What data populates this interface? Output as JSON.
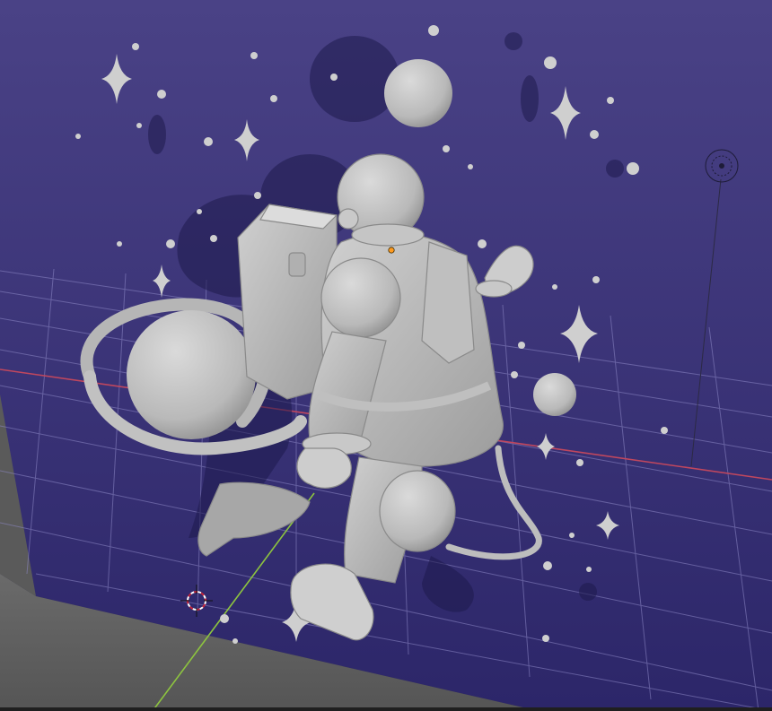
{
  "viewport": {
    "view": "3D Viewport",
    "shading": "solid",
    "colors": {
      "backdrop_top": "#4a4286",
      "backdrop_bottom": "#2a2466",
      "floor": "#5f5f5f",
      "grid": "#8d88c6",
      "x_axis": "#c0475e",
      "y_axis": "#8dc43f",
      "clay": "#c9c9c9",
      "clay_shadow": "#8f8f8f",
      "selection_origin": "#ff9a1f",
      "cursor": "#c8263b"
    },
    "objects": [
      "backdrop-plane",
      "astronaut",
      "ringed-planet",
      "moon",
      "small-moon",
      "stars",
      "grid-floor",
      "light-gizmo",
      "3d-cursor"
    ]
  }
}
